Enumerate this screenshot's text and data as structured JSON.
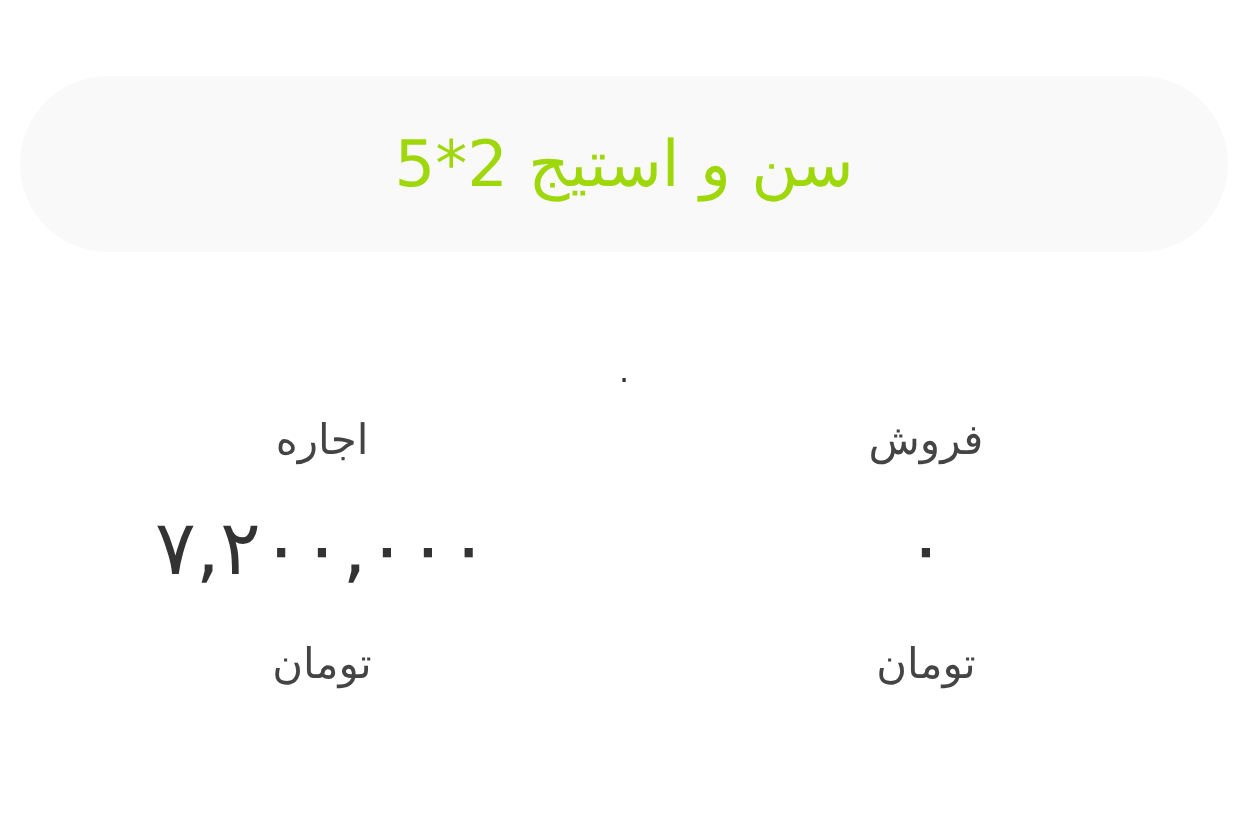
{
  "title": "سن و استیج 2*5",
  "separator": ".",
  "prices": [
    {
      "label": "فروش",
      "amount": "۰",
      "unit": "تومان"
    },
    {
      "label": "اجاره",
      "amount": "۷,۲۰۰,۰۰۰",
      "unit": "تومان"
    }
  ]
}
